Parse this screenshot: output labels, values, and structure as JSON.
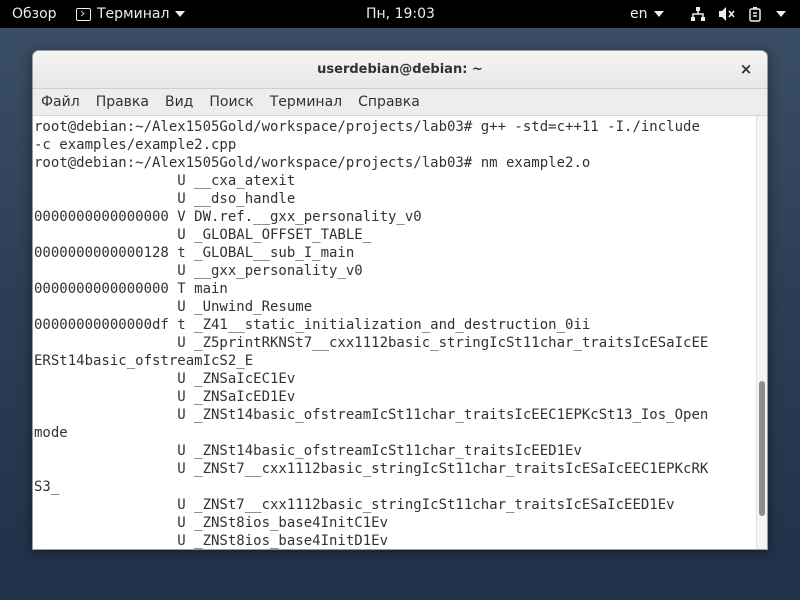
{
  "topbar": {
    "activities": "Обзор",
    "app_name": "Терминал",
    "clock": "Пн, 19:03",
    "lang": "en",
    "icons": [
      "network-icon",
      "volume-muted-icon",
      "battery-icon"
    ]
  },
  "window": {
    "title": "userdebian@debian: ~",
    "close_label": "×",
    "menu": [
      "Файл",
      "Правка",
      "Вид",
      "Поиск",
      "Терминал",
      "Справка"
    ],
    "scroll_position": 0.9
  },
  "terminal": {
    "lines": [
      "root@debian:~/Alex1505Gold/workspace/projects/lab03# g++ -std=c++11 -I./include",
      "-c examples/example2.cpp",
      "root@debian:~/Alex1505Gold/workspace/projects/lab03# nm example2.o",
      "                 U __cxa_atexit",
      "                 U __dso_handle",
      "0000000000000000 V DW.ref.__gxx_personality_v0",
      "                 U _GLOBAL_OFFSET_TABLE_",
      "0000000000000128 t _GLOBAL__sub_I_main",
      "                 U __gxx_personality_v0",
      "0000000000000000 T main",
      "                 U _Unwind_Resume",
      "00000000000000df t _Z41__static_initialization_and_destruction_0ii",
      "                 U _Z5printRKNSt7__cxx1112basic_stringIcSt11char_traitsIcESaIcEE",
      "ERSt14basic_ofstreamIcS2_E",
      "                 U _ZNSaIcEC1Ev",
      "                 U _ZNSaIcED1Ev",
      "                 U _ZNSt14basic_ofstreamIcSt11char_traitsIcEEC1EPKcSt13_Ios_Open",
      "mode",
      "                 U _ZNSt14basic_ofstreamIcSt11char_traitsIcEED1Ev",
      "                 U _ZNSt7__cxx1112basic_stringIcSt11char_traitsIcESaIcEEC1EPKcRK",
      "S3_",
      "                 U _ZNSt7__cxx1112basic_stringIcSt11char_traitsIcESaIcEED1Ev",
      "                 U _ZNSt8ios_base4InitC1Ev",
      "                 U _ZNSt8ios_base4InitD1Ev"
    ]
  }
}
